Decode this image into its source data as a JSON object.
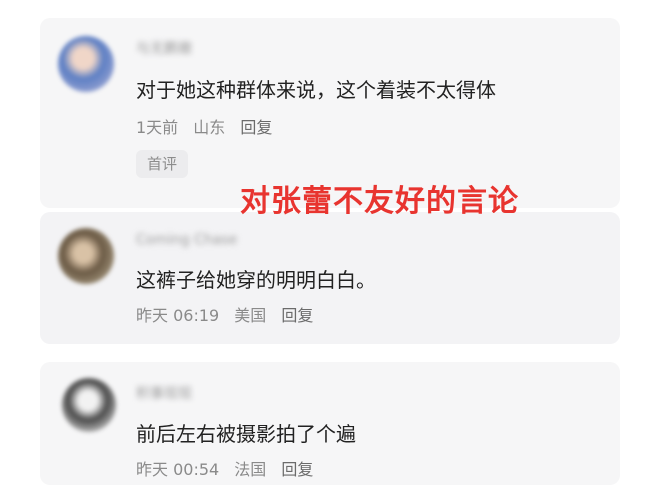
{
  "comments": [
    {
      "username": "与无鹏撤",
      "text": "对于她这种群体来说，这个着装不太得体",
      "time": "1天前",
      "location": "山东",
      "reply_label": "回复",
      "badge": "首评"
    },
    {
      "username": "Coming Chase",
      "text": "这裤子给她穿的明明白白。",
      "time": "昨天 06:19",
      "location": "美国",
      "reply_label": "回复"
    },
    {
      "username": "积事现现",
      "text": "前后左右被摄影拍了个遍",
      "time": "昨天 00:54",
      "location": "法国",
      "reply_label": "回复"
    }
  ],
  "overlay_caption": "对张蕾不友好的言论",
  "colors": {
    "overlay_text": "#e8342f",
    "meta_text": "#8a8a8a",
    "card_bg": "#f6f6f7"
  }
}
